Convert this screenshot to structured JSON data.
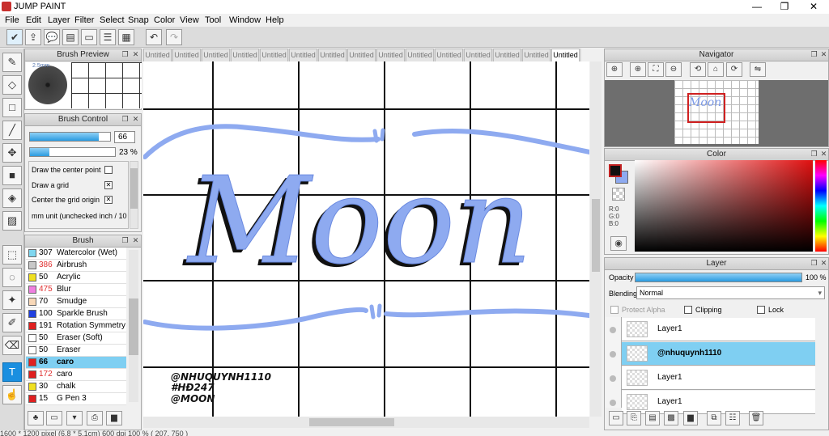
{
  "app": {
    "title": "JUMP PAINT",
    "minimize": "—",
    "maximize": "❐",
    "close": "✕"
  },
  "menu": [
    "File",
    "Edit",
    "Layer",
    "Filter",
    "Select",
    "Snap",
    "Color",
    "View",
    "Tool",
    "Window",
    "Help"
  ],
  "brush_preview": {
    "title": "Brush Preview",
    "size_label": "2.5mm"
  },
  "brush_control": {
    "title": "Brush Control",
    "size_value": "66",
    "size_fill": 0.86,
    "opacity_value": "23 %",
    "opacity_fill": 0.23,
    "options": [
      {
        "label": "Draw the center point",
        "checked": false
      },
      {
        "label": "Draw a grid",
        "checked": true
      },
      {
        "label": "Center the grid origin",
        "checked": true
      },
      {
        "label": "mm unit (unchecked inch / 10 un",
        "checked": null
      }
    ]
  },
  "brush_list": {
    "title": "Brush",
    "items": [
      {
        "num": "307",
        "name": "Watercolor (Wet)",
        "color": "#7fd7f0",
        "num_color": "#000"
      },
      {
        "num": "386",
        "name": "Airbrush",
        "color": "#c8c8c8",
        "num_color": "#e03030"
      },
      {
        "num": "50",
        "name": "Acrylic",
        "color": "#f0e020",
        "num_color": "#000"
      },
      {
        "num": "475",
        "name": "Blur",
        "color": "#f080e0",
        "num_color": "#e03030"
      },
      {
        "num": "70",
        "name": "Smudge",
        "color": "#f8d8b8",
        "num_color": "#000"
      },
      {
        "num": "100",
        "name": "Sparkle Brush",
        "color": "#2040e0",
        "num_color": "#000"
      },
      {
        "num": "191",
        "name": "Rotation Symmetry Pe",
        "color": "#e02020",
        "num_color": "#000"
      },
      {
        "num": "50",
        "name": "Eraser (Soft)",
        "color": "#ffffff",
        "num_color": "#000"
      },
      {
        "num": "50",
        "name": "Eraser",
        "color": "#ffffff",
        "num_color": "#000"
      },
      {
        "num": "66",
        "name": "caro",
        "color": "#e02020",
        "num_color": "#000",
        "selected": true
      },
      {
        "num": "172",
        "name": "caro",
        "color": "#e02020",
        "num_color": "#e03030"
      },
      {
        "num": "30",
        "name": "chalk",
        "color": "#f0e020",
        "num_color": "#000"
      },
      {
        "num": "15",
        "name": "G Pen 3",
        "color": "#e02020",
        "num_color": "#000"
      }
    ]
  },
  "tabs": [
    "Untitled",
    "Untitled",
    "Untitled",
    "Untitled",
    "Untitled",
    "Untitled",
    "Untitled",
    "Untitled",
    "Untitled",
    "Untitled",
    "Untitled",
    "Untitled",
    "Untitled",
    "Untitled",
    "Untitled"
  ],
  "canvas": {
    "lettering": "Moon",
    "credit_lines": [
      "@NHUQUYNH1110",
      "#HĐ247",
      "@MOON"
    ]
  },
  "navigator": {
    "title": "Navigator"
  },
  "color_panel": {
    "title": "Color",
    "r": "R:0",
    "g": "G:0",
    "b": "B:0"
  },
  "layer_panel": {
    "title": "Layer",
    "opacity_label": "Opacity",
    "opacity_value": "100 %",
    "opacity_fill": 1.0,
    "blending_label": "Blending",
    "blending_value": "Normal",
    "protect_alpha": "Protect Alpha",
    "clipping": "Clipping",
    "lock": "Lock",
    "layers": [
      {
        "name": "Layer1",
        "selected": false
      },
      {
        "name": "@nhuquynh1110",
        "selected": true
      },
      {
        "name": "Layer1",
        "selected": false
      },
      {
        "name": "Layer1",
        "selected": false
      }
    ]
  },
  "status": "1600 * 1200 pixel  (6.8 * 5.1cm)  600 dpi  100 %  ( 207, 750 )",
  "colors": {
    "accent": "#1a8fe0",
    "lettering_fill": "#8eaaf0",
    "selection": "#7fcff2"
  }
}
